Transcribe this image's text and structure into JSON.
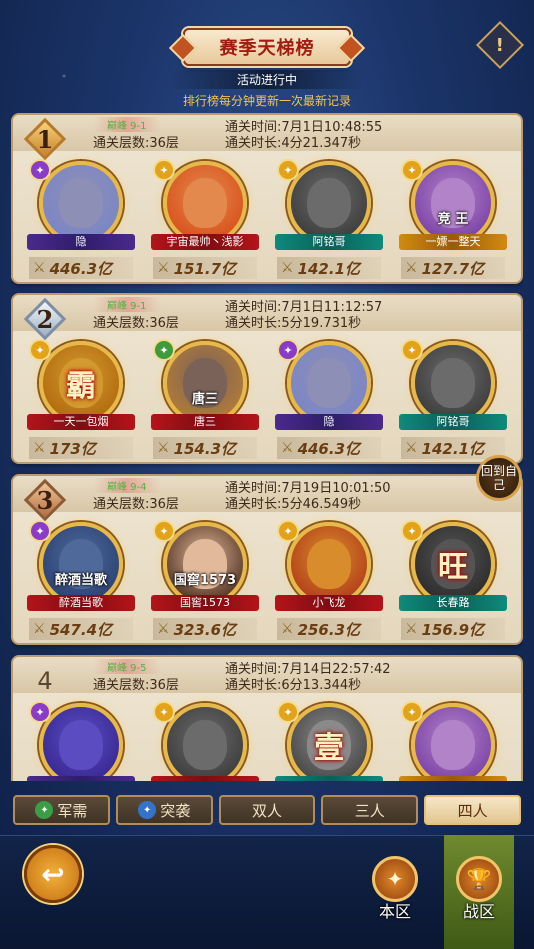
{
  "header": {
    "title": "赛季天梯榜",
    "status": "活动进行中",
    "notice": "排行榜每分钟更新一次最新记录"
  },
  "floating": {
    "return_self": "回到自己"
  },
  "ranks": [
    {
      "rank": "1",
      "peak": "巅峰 9-1",
      "floors": "通关层数:36层",
      "clear_time": "通关时间:7月1日10:48:55",
      "duration": "通关时长:4分21.347秒",
      "heroes": [
        {
          "name": "隐",
          "power": "446.3亿",
          "plate": "purple",
          "cls": "purple",
          "face": "#8e8fb6",
          "ring": "#7b86c5"
        },
        {
          "name": "宇宙最帅丶浅影",
          "power": "151.7亿",
          "plate": "red",
          "cls": "gold",
          "face": "#e3894d",
          "ring": "#d9541e"
        },
        {
          "name": "阿铭哥",
          "power": "142.1亿",
          "plate": "teal",
          "cls": "gold",
          "face": "#6b6b6b",
          "ring": "#3f3f3f"
        },
        {
          "name": "一嫖一整天",
          "power": "127.7亿",
          "plate": "gold",
          "cls": "gold",
          "face": "#b383c9",
          "ring": "#7e46a8",
          "overlay": "竞 王"
        }
      ]
    },
    {
      "rank": "2",
      "peak": "巅峰 9-1",
      "floors": "通关层数:36层",
      "clear_time": "通关时间:7月1日11:12:57",
      "duration": "通关时长:5分19.731秒",
      "heroes": [
        {
          "name": "一天一包烟",
          "power": "173亿",
          "plate": "red",
          "cls": "gold",
          "face": "#d29a2f",
          "ring": "#b46c10",
          "glyph": "霸"
        },
        {
          "name": "唐三",
          "power": "154.3亿",
          "plate": "red",
          "cls": "green",
          "face": "#7a6258",
          "ring": "#b07a3a",
          "overlay": "唐三"
        },
        {
          "name": "隐",
          "power": "446.3亿",
          "plate": "purple",
          "cls": "purple",
          "face": "#8e8fb6",
          "ring": "#7b86c5"
        },
        {
          "name": "阿铭哥",
          "power": "142.1亿",
          "plate": "teal",
          "cls": "gold",
          "face": "#6b6b6b",
          "ring": "#3f3f3f"
        }
      ]
    },
    {
      "rank": "3",
      "peak": "巅峰 9-4",
      "floors": "通关层数:36层",
      "clear_time": "通关时间:7月19日10:01:50",
      "duration": "通关时长:5分46.549秒",
      "heroes": [
        {
          "name": "醉酒当歌",
          "power": "547.4亿",
          "plate": "red",
          "cls": "purple",
          "face": "#4f6a9a",
          "ring": "#2d4475",
          "overlay": "醉酒当歌"
        },
        {
          "name": "国窖1573",
          "power": "323.6亿",
          "plate": "red",
          "cls": "gold",
          "face": "#e2b99a",
          "ring": "#5a3a2a",
          "overlay": "国窖1573"
        },
        {
          "name": "小飞龙",
          "power": "256.3亿",
          "plate": "red",
          "cls": "gold",
          "face": "#d88c2c",
          "ring": "#b4421a"
        },
        {
          "name": "长春路",
          "power": "156.9亿",
          "plate": "teal",
          "cls": "gold",
          "face": "#555555",
          "ring": "#2e2e2e",
          "glyph": "旺"
        }
      ]
    },
    {
      "rank": "4",
      "peak": "巅峰 9-5",
      "floors": "通关层数:36层",
      "clear_time": "通关时间:7月14日22:57:42",
      "duration": "通关时长:6分13.344秒",
      "heroes": [
        {
          "name": "",
          "power": "",
          "plate": "purple",
          "cls": "purple",
          "face": "#5b4cc2",
          "ring": "#3a2a95"
        },
        {
          "name": "",
          "power": "",
          "plate": "red",
          "cls": "gold",
          "face": "#6b6b6b",
          "ring": "#3f3f3f"
        },
        {
          "name": "",
          "power": "",
          "plate": "teal",
          "cls": "gold",
          "face": "#8a8a8a",
          "ring": "#4a4a4a",
          "glyph": "壹"
        },
        {
          "name": "",
          "power": "",
          "plate": "gold",
          "cls": "gold",
          "face": "#b383c9",
          "ring": "#7e46a8"
        }
      ]
    }
  ],
  "tabs": [
    {
      "label": "军需",
      "icon": "green"
    },
    {
      "label": "突袭",
      "icon": "blue"
    },
    {
      "label": "双人"
    },
    {
      "label": "三人"
    },
    {
      "label": "四人",
      "active": true
    }
  ],
  "footer": {
    "local_label": "本区",
    "zone_label": "战区"
  }
}
